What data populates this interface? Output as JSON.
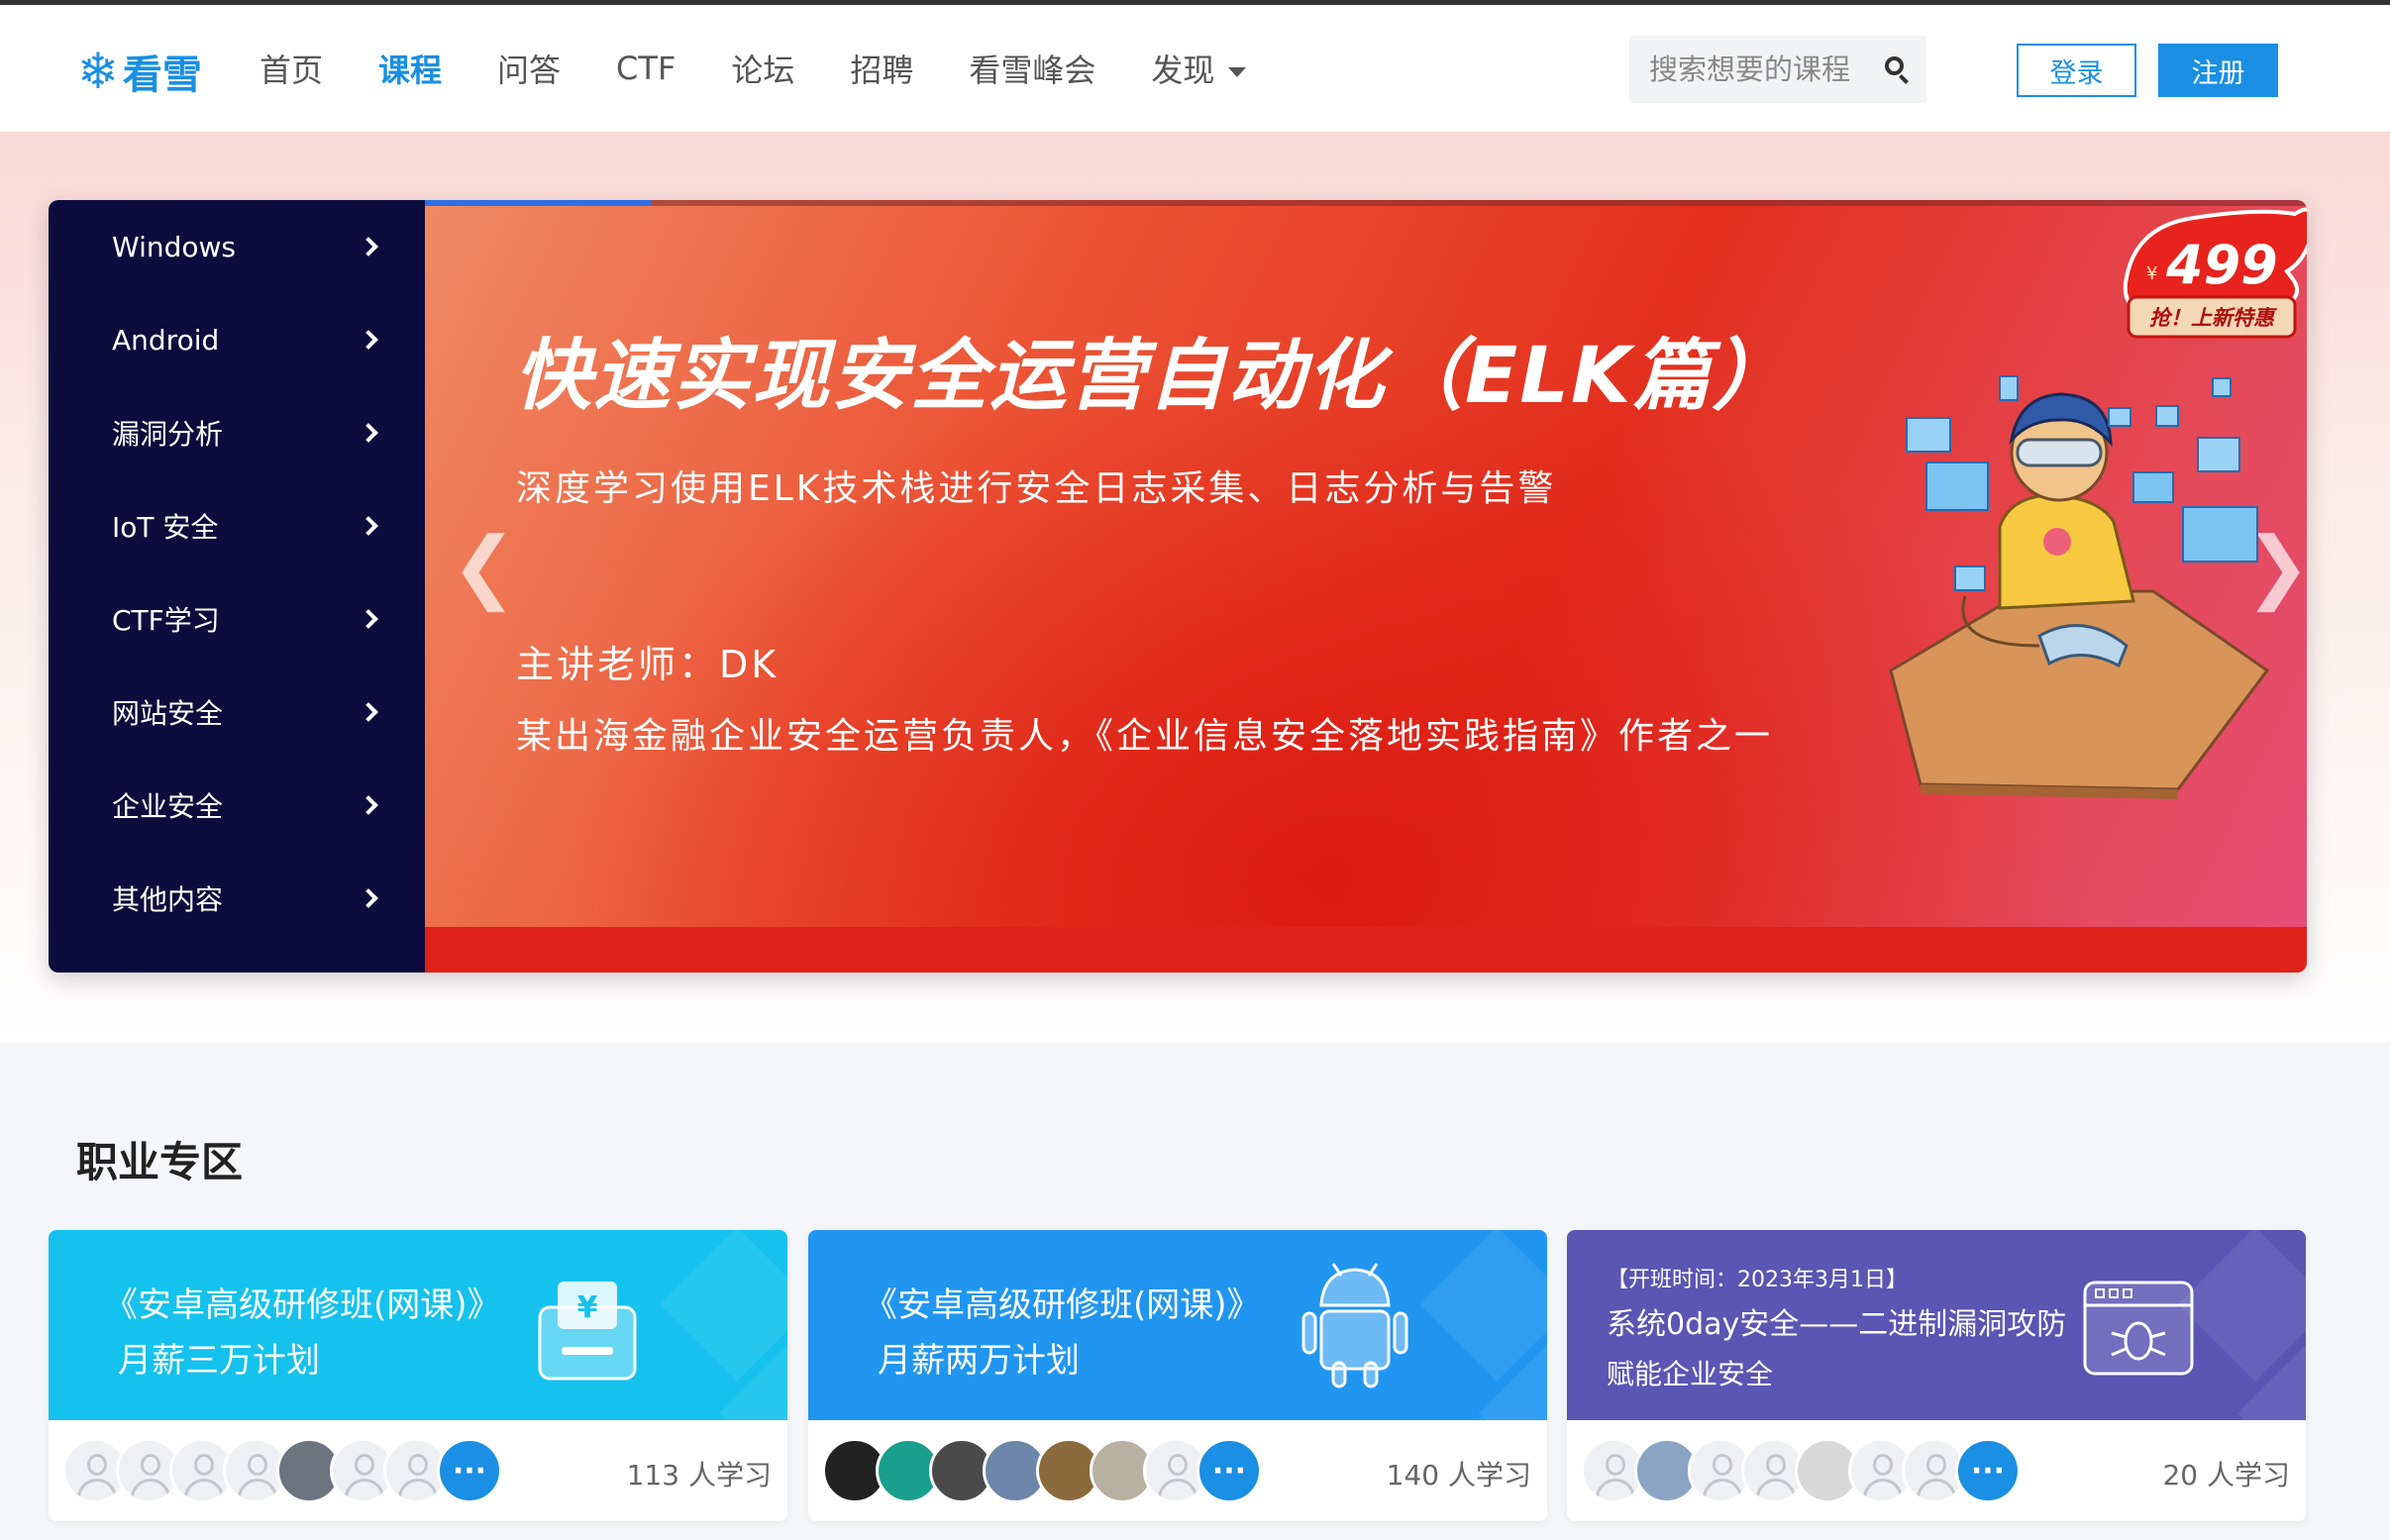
{
  "brand": {
    "logo_text": "看雪",
    "accent": "#1a8fe3"
  },
  "nav": {
    "items": [
      "首页",
      "课程",
      "问答",
      "CTF",
      "论坛",
      "招聘",
      "看雪峰会",
      "发现"
    ],
    "active_index": 1
  },
  "search": {
    "placeholder": "搜索想要的课程",
    "icon": "search-icon"
  },
  "auth": {
    "login_label": "登录",
    "register_label": "注册"
  },
  "side_menu": [
    "Windows",
    "Android",
    "漏洞分析",
    "IoT 安全",
    "CTF学习",
    "网站安全",
    "企业安全",
    "其他内容"
  ],
  "banner": {
    "title": "快速实现安全运营自动化（ELK篇）",
    "subtitle": "深度学习使用ELK技术栈进行安全日志采集、日志分析与告警",
    "teacher": "主讲老师：DK",
    "bio": "某出海金融企业安全运营负责人，《企业信息安全落地实践指南》作者之一",
    "price_symbol": "¥",
    "price": "499",
    "price_tag": "抢！上新特惠",
    "prev_arrow": "❮",
    "next_arrow": "❯",
    "progress_fraction": 0.12
  },
  "career": {
    "title": "职业专区",
    "cards": [
      {
        "line1": "《安卓高级研修班(网课)》",
        "line2": "月薪三万计划",
        "learners": "113 人学习",
        "more": "···"
      },
      {
        "line1": "《安卓高级研修班(网课)》",
        "line2": "月薪两万计划",
        "learners": "140 人学习",
        "more": "···"
      },
      {
        "date": "【开班时间：2023年3月1日】",
        "line1": "系统0day安全——二进制漏洞攻防",
        "line2": "赋能企业安全",
        "learners": "20 人学习",
        "more": "···"
      }
    ]
  }
}
